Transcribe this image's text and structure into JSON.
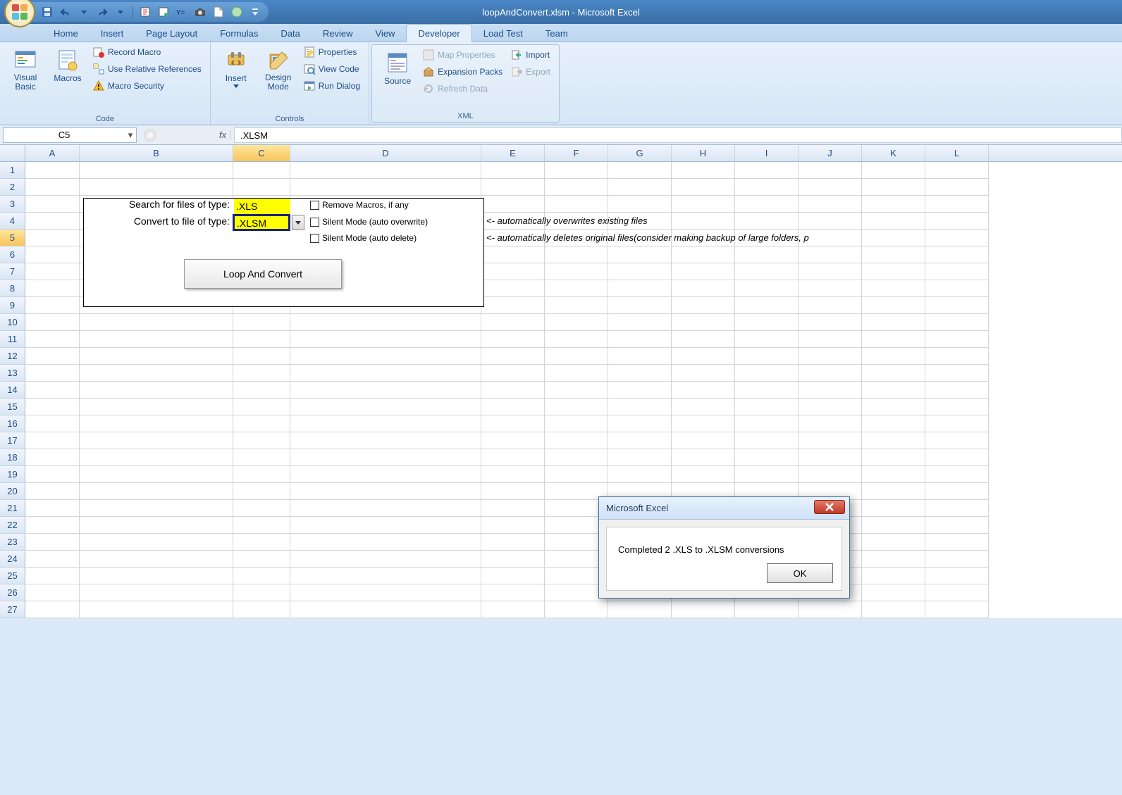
{
  "title": "loopAndConvert.xlsm - Microsoft Excel",
  "tabs": [
    "Home",
    "Insert",
    "Page Layout",
    "Formulas",
    "Data",
    "Review",
    "View",
    "Developer",
    "Load Test",
    "Team"
  ],
  "active_tab": "Developer",
  "ribbon": {
    "code": {
      "label": "Code",
      "visual_basic": "Visual Basic",
      "macros": "Macros",
      "record_macro": "Record Macro",
      "use_relative": "Use Relative References",
      "macro_security": "Macro Security"
    },
    "controls": {
      "label": "Controls",
      "insert": "Insert",
      "design_mode": "Design Mode",
      "properties": "Properties",
      "view_code": "View Code",
      "run_dialog": "Run Dialog"
    },
    "xml": {
      "label": "XML",
      "source": "Source",
      "map_properties": "Map Properties",
      "expansion_packs": "Expansion Packs",
      "refresh_data": "Refresh Data",
      "import": "Import",
      "export": "Export"
    }
  },
  "name_box": "C5",
  "fx": "fx",
  "formula_value": ".XLSM",
  "columns": [
    "A",
    "B",
    "C",
    "D",
    "E",
    "F",
    "G",
    "H",
    "I",
    "J",
    "K",
    "L"
  ],
  "row_numbers": [
    "1",
    "2",
    "3",
    "4",
    "5",
    "6",
    "7",
    "8",
    "9",
    "10",
    "11",
    "12",
    "13",
    "14",
    "15",
    "16",
    "17",
    "18",
    "19",
    "20",
    "21",
    "22",
    "23",
    "24",
    "25",
    "26",
    "27"
  ],
  "sheet": {
    "label_search": "Search for files of type:",
    "label_convert": "Convert to file of type:",
    "val_search": ".XLS",
    "val_convert": ".XLSM",
    "cb_remove": "Remove Macros, if any",
    "cb_silent_overwrite": "Silent Mode (auto overwrite)",
    "cb_silent_delete": "Silent Mode (auto delete)",
    "note_overwrite": "<- automatically overwrites existing files",
    "note_delete": "<- automatically deletes original files(consider making backup of large folders, p",
    "button_label": "Loop And Convert"
  },
  "msgbox": {
    "title": "Microsoft Excel",
    "body": "Completed 2 .XLS to .XLSM conversions",
    "ok": "OK"
  }
}
